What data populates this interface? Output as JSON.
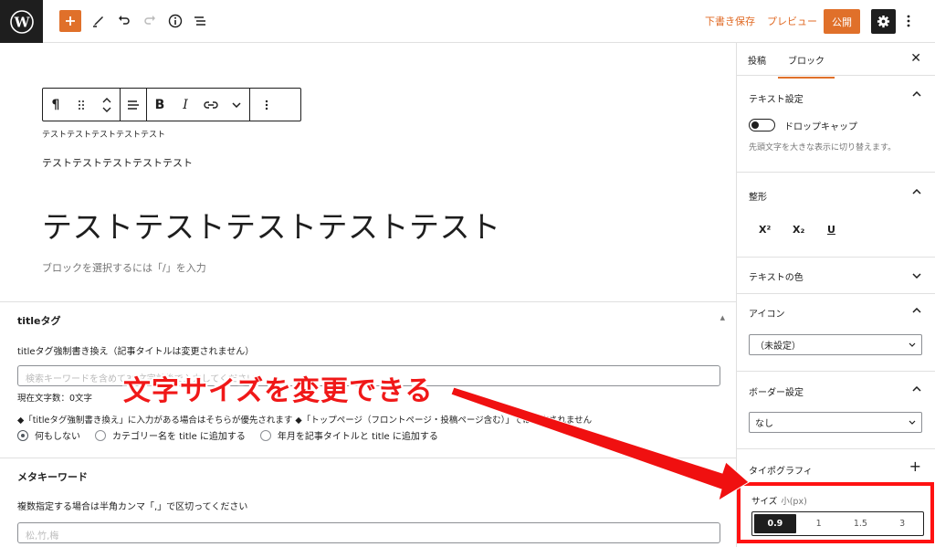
{
  "toolbar": {
    "save_draft": "下書き保存",
    "preview": "プレビュー",
    "publish": "公開"
  },
  "editor": {
    "small_text": "テストテストテストテストテスト",
    "paragraph": "テストテストテストテストテスト",
    "heading": "テストテストテストテストテスト",
    "placeholder": "ブロックを選択するには「/」を入力"
  },
  "meta": {
    "title_tag": {
      "title": "titleタグ",
      "label": "titleタグ強制書き換え（記事タイトルは変更されません）",
      "placeholder": "検索キーワードを含めて32文字前後で入力してください",
      "count": "現在文字数：0文字",
      "note": "◆「titleタグ強制書き換え」に入力がある場合はそちらが優先されます ◆「トップページ（フロントページ・投稿ページ含む）」では適応されません",
      "options": [
        "何もしない",
        "カテゴリー名を title に追加する",
        "年月を記事タイトルと title に追加する"
      ]
    },
    "keywords": {
      "title": "メタキーワード",
      "label": "複数指定する場合は半角カンマ「,」で区切ってください",
      "placeholder": "松,竹,梅"
    }
  },
  "annotation": {
    "text": "文字サイズを変更できる",
    "color": "#f01818"
  },
  "sidebar": {
    "tabs": [
      "投稿",
      "ブロック"
    ],
    "text_settings": {
      "title": "テキスト設定",
      "dropcap": "ドロップキャップ",
      "dropcap_help": "先頭文字を大きな表示に切り替えます。"
    },
    "format": {
      "title": "整形",
      "buttons": [
        "X²",
        "X₂",
        "U"
      ]
    },
    "text_color": {
      "title": "テキストの色"
    },
    "icon": {
      "title": "アイコン",
      "value": "（未設定）"
    },
    "border": {
      "title": "ボーダー設定",
      "value": "なし"
    },
    "typography": {
      "title": "タイポグラフィ"
    },
    "size": {
      "label": "サイズ",
      "unit": "小(px)",
      "options": [
        "0.9",
        "1",
        "1.5",
        "3"
      ],
      "selected": "0.9"
    }
  },
  "colors": {
    "accent": "#e0702a",
    "dark": "#1e1e1e",
    "highlight": "#ff1212"
  }
}
